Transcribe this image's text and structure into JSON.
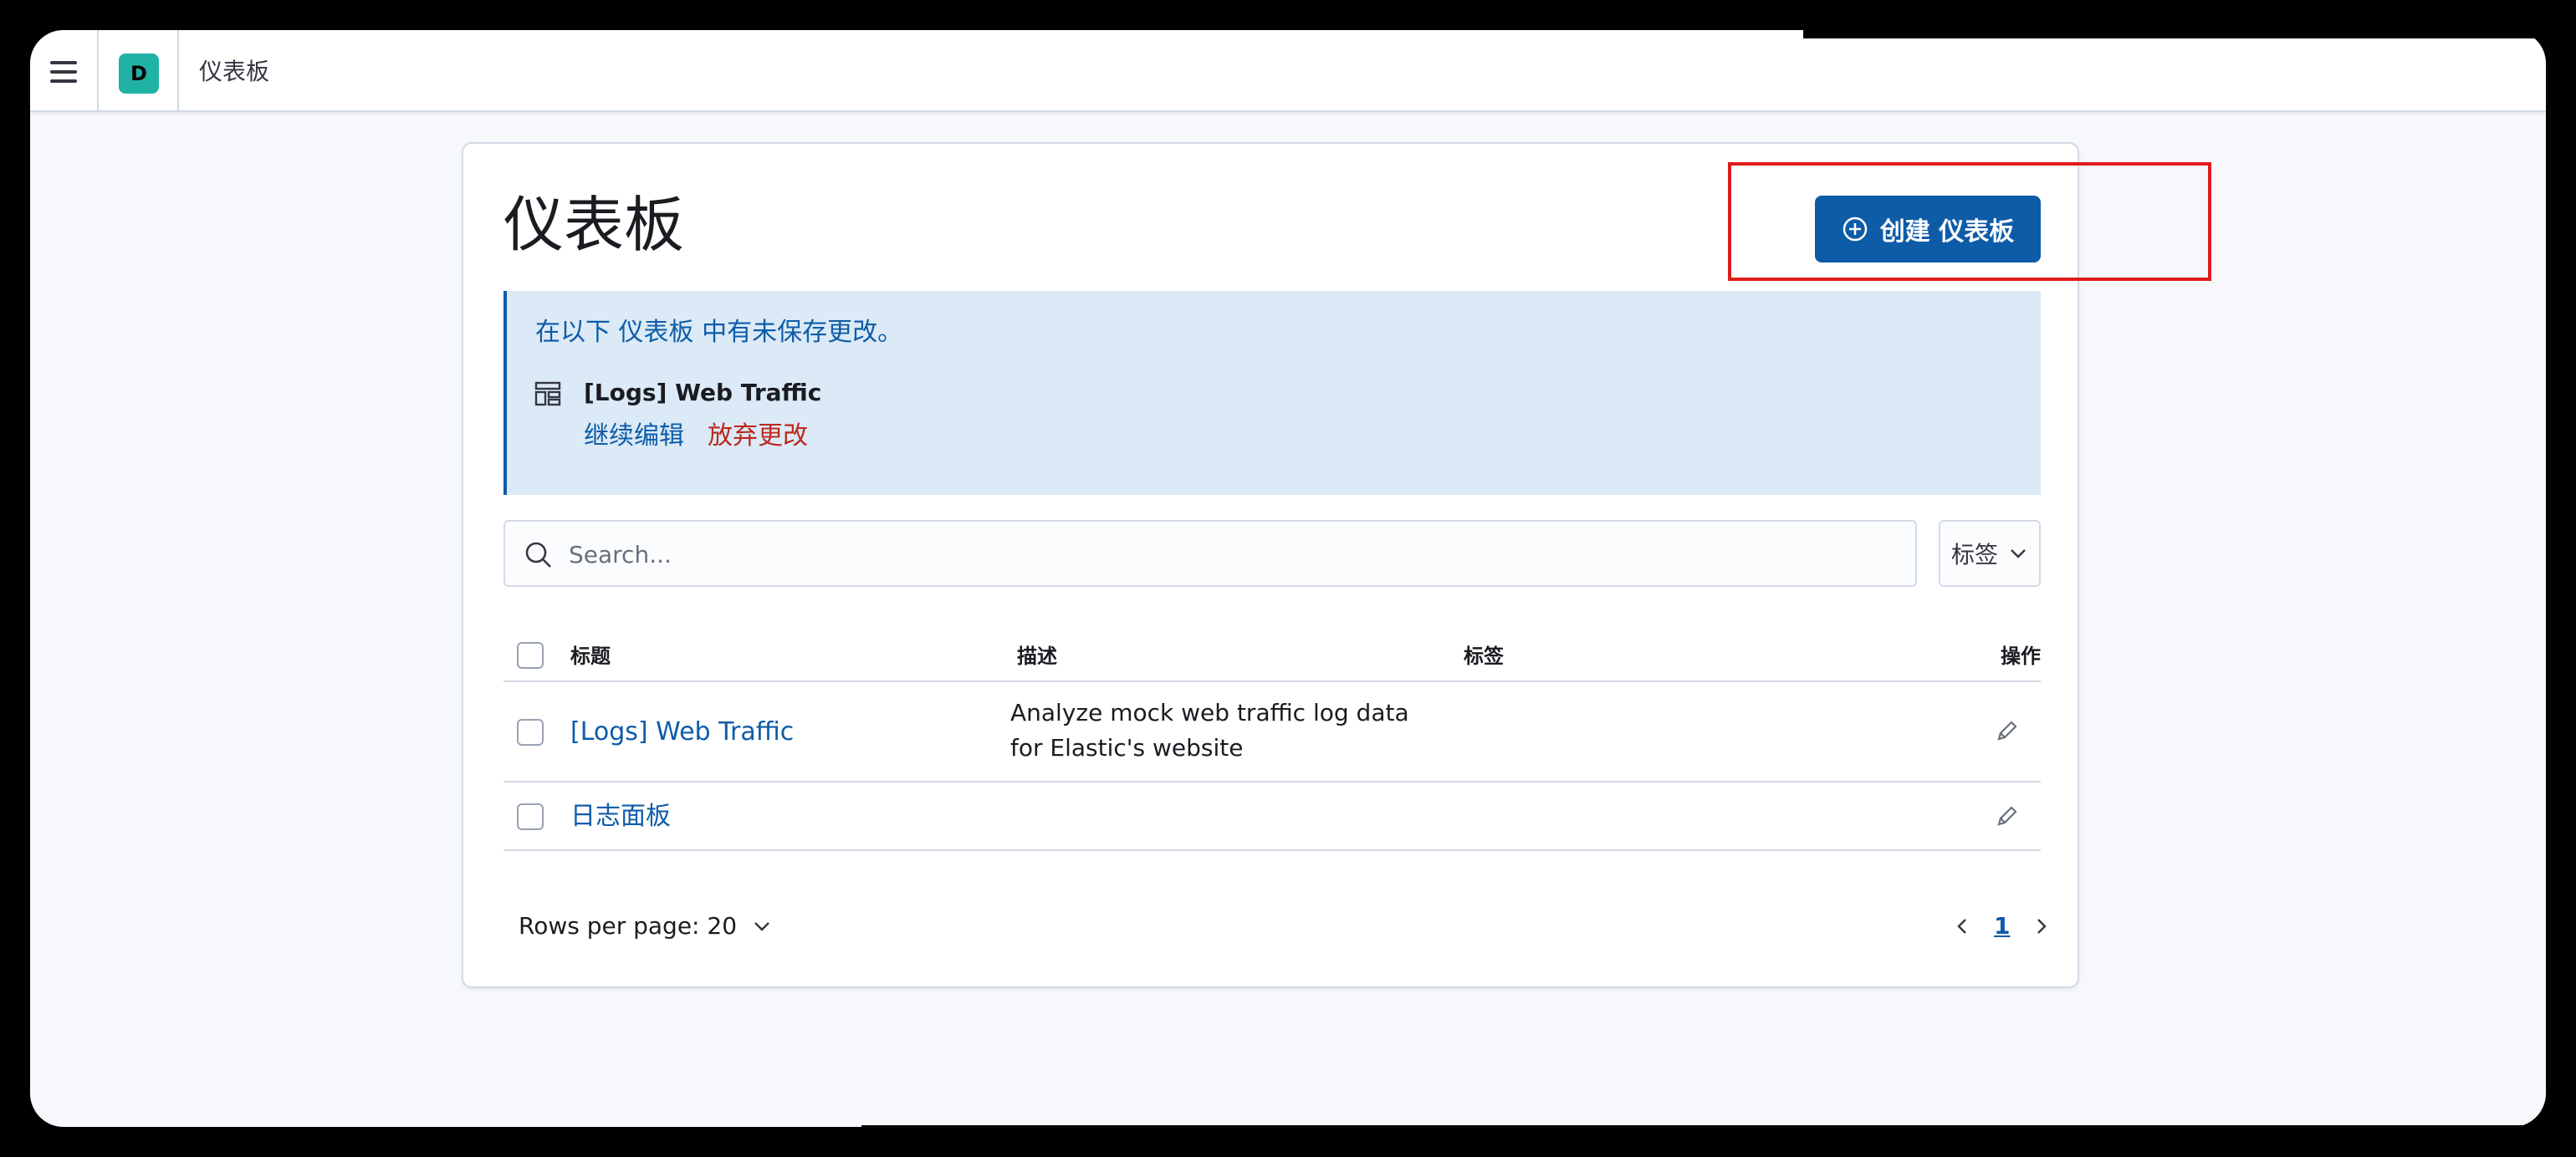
{
  "header": {
    "space_avatar": "D",
    "breadcrumb": "仪表板"
  },
  "page": {
    "title": "仪表板",
    "create_button": "创建 仪表板"
  },
  "callout": {
    "message": "在以下 仪表板 中有未保存更改。",
    "item_name": "[Logs] Web Traffic",
    "continue_label": "继续编辑",
    "discard_label": "放弃更改"
  },
  "search": {
    "placeholder": "Search...",
    "tags_filter_label": "标签"
  },
  "table": {
    "headers": {
      "title": "标题",
      "description": "描述",
      "tags": "标签",
      "actions": "操作"
    },
    "rows": [
      {
        "title": "[Logs] Web Traffic",
        "description": "Analyze mock web traffic log data for Elastic's website"
      },
      {
        "title": "日志面板",
        "description": ""
      }
    ]
  },
  "pagination": {
    "rows_per_page": "Rows per page: 20",
    "current_page": "1"
  },
  "icons": {
    "menu": "menu-icon",
    "plus": "plus-circle-icon",
    "dashboard": "dashboard-icon",
    "search": "search-icon",
    "chevron": "chevron-down-icon",
    "edit": "pencil-icon"
  },
  "colors": {
    "primary": "#0e5ca8",
    "danger": "#bd271e",
    "callout_bg": "#dbeaf6",
    "avatar": "#20b2a5",
    "highlight": "#e01b1b"
  }
}
